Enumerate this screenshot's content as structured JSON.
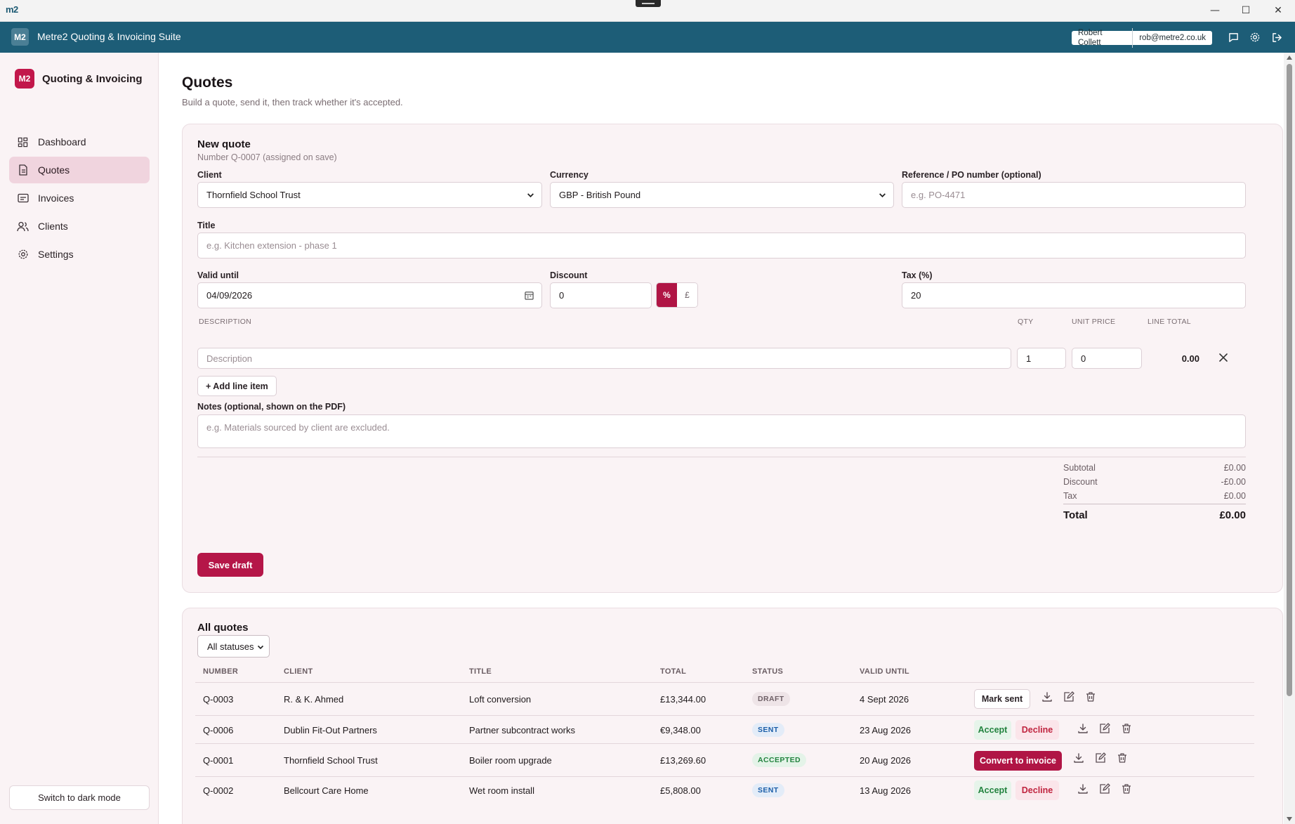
{
  "window": {
    "logo": "m2",
    "minimize": "—",
    "maximize": "☐",
    "close": "✕"
  },
  "header": {
    "badge": "M2",
    "title": "Metre2 Quoting & Invoicing Suite",
    "user_name": "Robert Collett",
    "user_email": "rob@metre2.co.uk",
    "icons": [
      "chat-icon",
      "gear-icon",
      "logout-icon"
    ]
  },
  "sidebar": {
    "brand_badge": "M2",
    "brand_name": "Quoting & Invoicing",
    "items": [
      {
        "label": "Dashboard",
        "icon": "dashboard-icon"
      },
      {
        "label": "Quotes",
        "icon": "document-icon",
        "active": true
      },
      {
        "label": "Invoices",
        "icon": "invoice-icon"
      },
      {
        "label": "Clients",
        "icon": "users-icon"
      },
      {
        "label": "Settings",
        "icon": "gear-icon"
      }
    ],
    "dark_mode": "Switch to dark mode"
  },
  "page": {
    "title": "Quotes",
    "subtitle": "Build a quote, send it, then track whether it's accepted."
  },
  "new_quote": {
    "heading": "New quote",
    "number_note": "Number Q-0007 (assigned on save)",
    "client_label": "Client",
    "client_value": "Thornfield School Trust",
    "currency_label": "Currency",
    "currency_value": "GBP - British Pound",
    "ref_label": "Reference / PO number (optional)",
    "ref_placeholder": "e.g. PO-4471",
    "title_label": "Title",
    "title_placeholder": "e.g. Kitchen extension - phase 1",
    "valid_label": "Valid until",
    "valid_value": "04/09/2026",
    "discount_label": "Discount",
    "discount_value": "0",
    "discount_pct": "%",
    "discount_gbp": "£",
    "tax_label": "Tax (%)",
    "tax_value": "20",
    "col_description": "DESCRIPTION",
    "col_qty": "QTY",
    "col_unit_price": "UNIT PRICE",
    "col_line_total": "LINE TOTAL",
    "line": {
      "description_placeholder": "Description",
      "qty": "1",
      "unit_price": "0",
      "line_total": "0.00"
    },
    "add_line": "+ Add line item",
    "notes_label": "Notes (optional, shown on the PDF)",
    "notes_placeholder": "e.g. Materials sourced by client are excluded.",
    "subtotal_label": "Subtotal",
    "subtotal_value": "£0.00",
    "discount_row_label": "Discount",
    "discount_row_value": "-£0.00",
    "tax_row_label": "Tax",
    "tax_row_value": "£0.00",
    "total_label": "Total",
    "total_value": "£0.00",
    "save": "Save draft"
  },
  "all_quotes": {
    "heading": "All quotes",
    "filter": "All statuses",
    "columns": [
      "NUMBER",
      "CLIENT",
      "TITLE",
      "TOTAL",
      "STATUS",
      "VALID UNTIL"
    ],
    "rows": [
      {
        "number": "Q-0003",
        "client": "R. & K. Ahmed",
        "title": "Loft conversion",
        "total": "£13,344.00",
        "status": "DRAFT",
        "valid": "4 Sept 2026",
        "actions": [
          "Mark sent"
        ]
      },
      {
        "number": "Q-0006",
        "client": "Dublin Fit-Out Partners",
        "title": "Partner subcontract works",
        "total": "€9,348.00",
        "status": "SENT",
        "valid": "23 Aug 2026",
        "actions": [
          "Accept",
          "Decline"
        ]
      },
      {
        "number": "Q-0001",
        "client": "Thornfield School Trust",
        "title": "Boiler room upgrade",
        "total": "£13,269.60",
        "status": "ACCEPTED",
        "valid": "20 Aug 2026",
        "actions": [
          "Convert to invoice"
        ]
      },
      {
        "number": "Q-0002",
        "client": "Bellcourt Care Home",
        "title": "Wet room install",
        "total": "£5,808.00",
        "status": "SENT",
        "valid": "13 Aug 2026",
        "actions": [
          "Accept",
          "Decline"
        ]
      }
    ]
  },
  "colors": {
    "header": "#1d5d77",
    "accent": "#b51648",
    "sidebar_bg": "#faf3f5"
  }
}
